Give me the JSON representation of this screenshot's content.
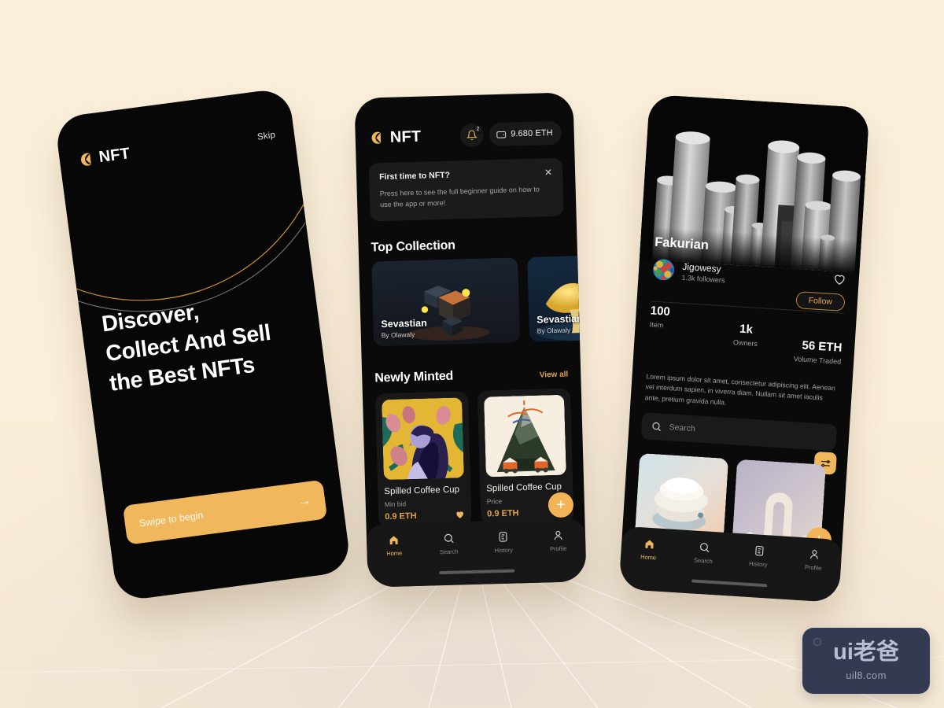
{
  "background": {
    "color": "#fbeeda",
    "accent": "#f0b75c"
  },
  "phone1": {
    "logo_text": "NFT",
    "skip_label": "Skip",
    "headline_lines": [
      "Discover,",
      "Collect And Sell",
      "the Best NFTs"
    ],
    "swipe_label": "Swipe to begin",
    "swipe_arrow": "→"
  },
  "phone2": {
    "logo_text": "NFT",
    "notification_badge": "2",
    "wallet_balance": "9.680 ETH",
    "banner": {
      "title": "First time to NFT?",
      "body": "Press here to see the full beginner guide on how to use the app or more!",
      "close_icon": "✕"
    },
    "section_top_collection": "Top Collection",
    "collections": [
      {
        "name": "Sevastian",
        "by": "By Olawaly"
      },
      {
        "name": "Sevastian",
        "by": "By Olawaly"
      }
    ],
    "section_newly_minted": "Newly Minted",
    "view_all": "View all",
    "minted": [
      {
        "name": "Spilled Coffee Cup",
        "sub_label": "Min bid",
        "price": "0.9 ETH",
        "liked": true
      },
      {
        "name": "Spilled Coffee Cup",
        "sub_label": "Price",
        "price": "0.9 ETH",
        "liked": false
      }
    ],
    "fab_label": "+",
    "nav": [
      {
        "label": "Home",
        "icon": "home-icon",
        "active": true
      },
      {
        "label": "Search",
        "icon": "search-icon",
        "active": false
      },
      {
        "label": "History",
        "icon": "history-icon",
        "active": false
      },
      {
        "label": "Profile",
        "icon": "profile-icon",
        "active": false
      }
    ]
  },
  "phone3": {
    "collection_title": "Fakurian",
    "creator_name": "Jigowesy",
    "creator_followers": "1.3k followers",
    "follow_label": "Follow",
    "stats": [
      {
        "value": "100",
        "key": "Item"
      },
      {
        "value": "1k",
        "key": "Owners"
      },
      {
        "value": "56 ETH",
        "key": "Volume Traded"
      }
    ],
    "description": "Lorem ipsum dolor sit amet, consectetur adipiscing elit. Aenean vel interdum sapien, in viverra diam. Nullam sit amet iaculis ante, pretium gravida nulla.",
    "search_placeholder": "Search",
    "fab_label": "+",
    "nav": [
      {
        "label": "Home",
        "icon": "home-icon",
        "active": true
      },
      {
        "label": "Search",
        "icon": "search-icon",
        "active": false
      },
      {
        "label": "History",
        "icon": "history-icon",
        "active": false
      },
      {
        "label": "Profile",
        "icon": "profile-icon",
        "active": false
      }
    ]
  },
  "watermark": {
    "main": "ui老爸",
    "sub": "uil8.com"
  }
}
